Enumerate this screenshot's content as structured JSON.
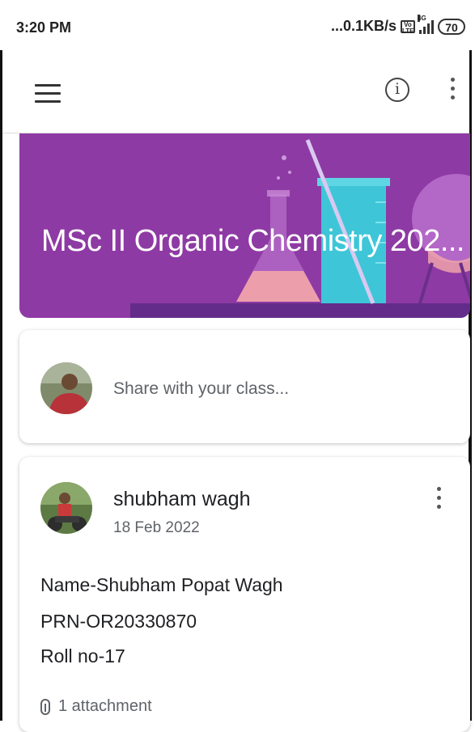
{
  "status_bar": {
    "time": "3:20 PM",
    "network_speed": "...0.1KB/s",
    "volte_icon": "volte-lte-icon",
    "network_type": "4G",
    "signal_icon": "signal-icon",
    "battery": "70"
  },
  "app_bar": {
    "menu_icon": "hamburger-menu-icon",
    "info_icon": "info-icon",
    "more_icon": "more-vert-icon"
  },
  "banner": {
    "title": "MSc II Organic Chemistry 202...",
    "background_color": "#8e3aa4"
  },
  "share": {
    "placeholder": "Share with your class..."
  },
  "post": {
    "author": "shubham wagh",
    "date": "18 Feb 2022",
    "lines": [
      "Name-Shubham Popat Wagh",
      "PRN-OR20330870",
      "Roll no-17"
    ],
    "attachment_label": "1 attachment",
    "attachment_icon": "paperclip-icon",
    "more_icon": "more-vert-icon"
  }
}
